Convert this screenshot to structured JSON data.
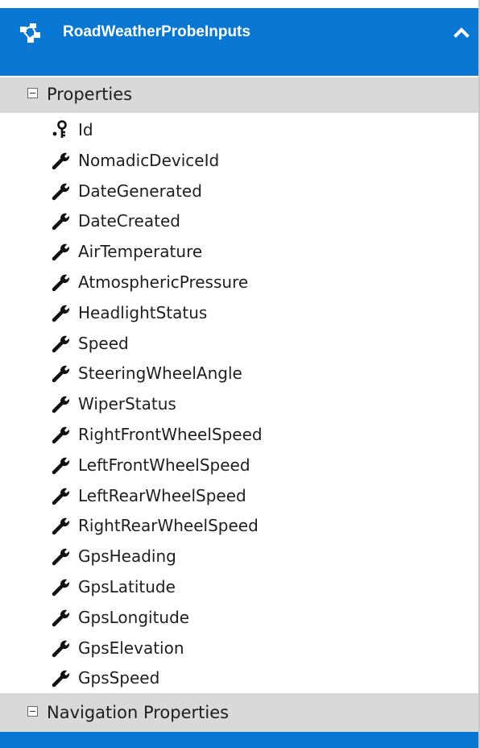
{
  "entity": {
    "title": "RoadWeatherProbeInputs",
    "accent_color": "#0a78d2",
    "header_icon": "entity-type-icon",
    "collapse_icon": "chevron-up-icon"
  },
  "sections": {
    "properties_label": "Properties",
    "navigation_label": "Navigation Properties"
  },
  "properties": [
    {
      "name": "Id",
      "icon": "key-icon"
    },
    {
      "name": "NomadicDeviceId",
      "icon": "wrench-icon"
    },
    {
      "name": "DateGenerated",
      "icon": "wrench-icon"
    },
    {
      "name": "DateCreated",
      "icon": "wrench-icon"
    },
    {
      "name": "AirTemperature",
      "icon": "wrench-icon"
    },
    {
      "name": "AtmosphericPressure",
      "icon": "wrench-icon"
    },
    {
      "name": "HeadlightStatus",
      "icon": "wrench-icon"
    },
    {
      "name": "Speed",
      "icon": "wrench-icon"
    },
    {
      "name": "SteeringWheelAngle",
      "icon": "wrench-icon"
    },
    {
      "name": "WiperStatus",
      "icon": "wrench-icon"
    },
    {
      "name": "RightFrontWheelSpeed",
      "icon": "wrench-icon"
    },
    {
      "name": "LeftFrontWheelSpeed",
      "icon": "wrench-icon"
    },
    {
      "name": "LeftRearWheelSpeed",
      "icon": "wrench-icon"
    },
    {
      "name": "RightRearWheelSpeed",
      "icon": "wrench-icon"
    },
    {
      "name": "GpsHeading",
      "icon": "wrench-icon"
    },
    {
      "name": "GpsLatitude",
      "icon": "wrench-icon"
    },
    {
      "name": "GpsLongitude",
      "icon": "wrench-icon"
    },
    {
      "name": "GpsElevation",
      "icon": "wrench-icon"
    },
    {
      "name": "GpsSpeed",
      "icon": "wrench-icon"
    }
  ]
}
